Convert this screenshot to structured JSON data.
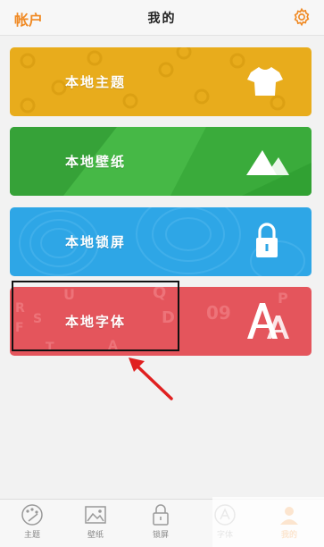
{
  "header": {
    "account_label": "帐户",
    "title": "我的",
    "settings_icon": "gear-icon"
  },
  "cards": [
    {
      "label": "本地主题",
      "icon": "tshirt-icon",
      "color": "#e8ac1c"
    },
    {
      "label": "本地壁纸",
      "icon": "mountain-icon",
      "color": "#3fb040"
    },
    {
      "label": "本地锁屏",
      "icon": "lock-icon",
      "color": "#2ea6e6"
    },
    {
      "label": "本地字体",
      "icon": "font-letters-icon",
      "color": "#e4555c"
    }
  ],
  "font_card_deco": [
    "Q",
    "U",
    "R",
    "F",
    "S",
    "D",
    "09",
    "P",
    "T",
    "A"
  ],
  "tabs": [
    {
      "label": "主题",
      "icon": "palette-icon",
      "active": false
    },
    {
      "label": "壁纸",
      "icon": "picture-icon",
      "active": false
    },
    {
      "label": "锁屏",
      "icon": "lock-icon",
      "active": false
    },
    {
      "label": "字体",
      "icon": "font-icon",
      "active": false
    },
    {
      "label": "我的",
      "icon": "user-icon",
      "active": true
    }
  ],
  "colors": {
    "accent": "#f08a24",
    "annotation_arrow": "#e02020",
    "annotation_box": "#111111"
  }
}
